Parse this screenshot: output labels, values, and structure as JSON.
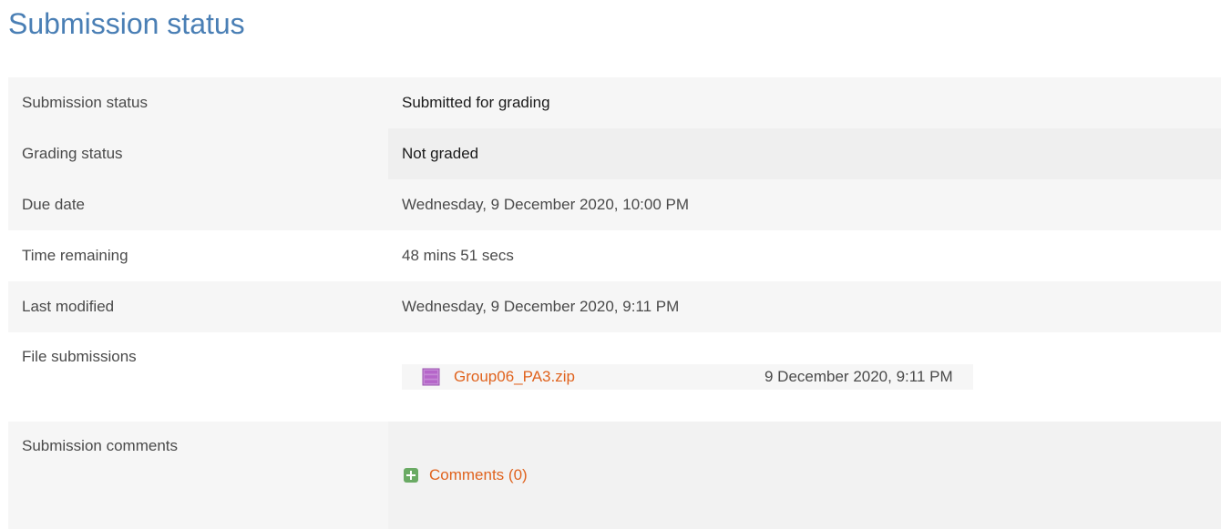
{
  "page": {
    "title": "Submission status"
  },
  "rows": [
    {
      "label": "Submission status",
      "value": "Submitted for grading"
    },
    {
      "label": "Grading status",
      "value": "Not graded"
    },
    {
      "label": "Due date",
      "value": "Wednesday, 9 December 2020, 10:00 PM"
    },
    {
      "label": "Time remaining",
      "value": "48 mins 51 secs"
    },
    {
      "label": "Last modified",
      "value": "Wednesday, 9 December 2020, 9:11 PM"
    }
  ],
  "file_submissions": {
    "label": "File submissions",
    "files": [
      {
        "name": "Group06_PA3.zip",
        "date": "9 December 2020, 9:11 PM",
        "icon": "archive-icon"
      }
    ]
  },
  "submission_comments": {
    "label": "Submission comments",
    "link_label": "Comments (0)",
    "icon": "plus-icon"
  },
  "colors": {
    "title": "#4a7fb5",
    "link": "#e0631e",
    "plus_icon": "#6aaa64",
    "archive_icon": "#b565c9"
  }
}
